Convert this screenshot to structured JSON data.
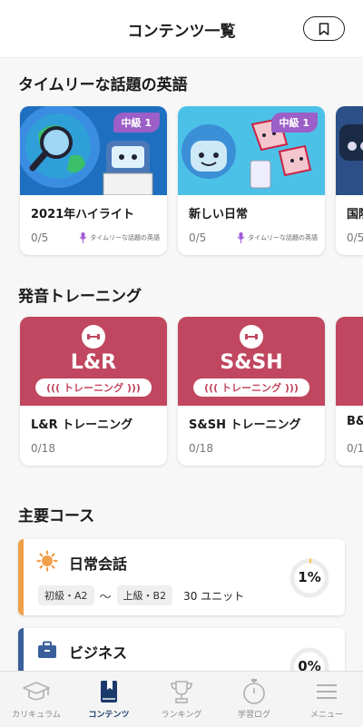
{
  "header": {
    "title": "コンテンツ一覧",
    "bookmark_icon": "bookmark-icon"
  },
  "topical": {
    "title": "タイムリーな話題の英語",
    "cards": [
      {
        "title": "2021年ハイライト",
        "badge": "中級 1",
        "progress": "0/5",
        "tag": "タイムリーな話題の英語"
      },
      {
        "title": "新しい日常",
        "badge": "中級 1",
        "progress": "0/5",
        "tag": "タイムリーな話題の英語"
      },
      {
        "title": "国際",
        "progress": "0/5"
      }
    ]
  },
  "pronunciation": {
    "title": "発音トレーニング",
    "cards": [
      {
        "name": "L&R",
        "pill": "トレーニング",
        "title": "L&R トレーニング",
        "progress": "0/18"
      },
      {
        "name": "S&SH",
        "pill": "トレーニング",
        "title": "S&SH トレーニング",
        "progress": "0/18"
      },
      {
        "title": "B&",
        "progress": "0/1"
      }
    ]
  },
  "courses": {
    "title": "主要コース",
    "items": [
      {
        "name": "日常会話",
        "from": "初級・A2",
        "tilde": "〜",
        "to": "上級・B2",
        "units": "30 ユニット",
        "progress_pct": 1,
        "pct_label": "1%",
        "accent": "#f0a04b",
        "icon": "sun-icon"
      },
      {
        "name": "ビジネス",
        "progress_pct": 0,
        "pct_label": "0%",
        "accent": "#3a5f9a",
        "icon": "briefcase-icon"
      }
    ]
  },
  "tabbar": {
    "tabs": [
      {
        "label": "カリキュラム",
        "icon": "graduation-cap-icon",
        "active": false
      },
      {
        "label": "コンテンツ",
        "icon": "book-icon",
        "active": true
      },
      {
        "label": "ランキング",
        "icon": "trophy-icon",
        "active": false
      },
      {
        "label": "学習ログ",
        "icon": "stopwatch-icon",
        "active": false
      },
      {
        "label": "メニュー",
        "icon": "menu-icon",
        "active": false
      }
    ]
  },
  "colors": {
    "accent_navy": "#1b3a6b",
    "pronunciation_red": "#c0475f",
    "badge_purple": "#9b5fc7"
  }
}
